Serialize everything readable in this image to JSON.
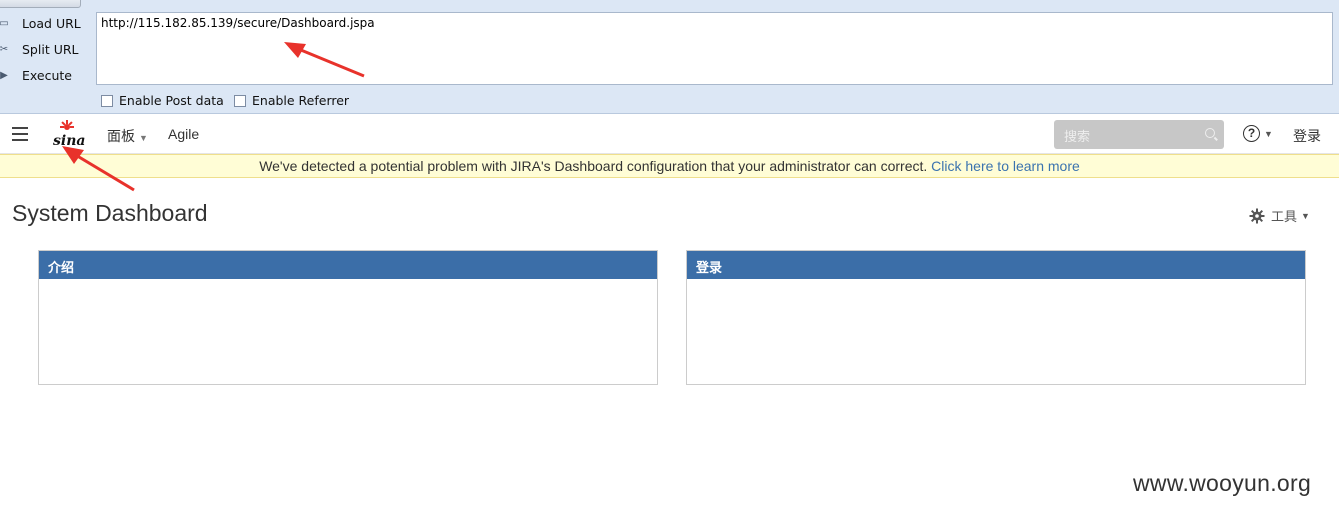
{
  "hackbar": {
    "load_url_label": "Load URL",
    "split_url_label": "Split URL",
    "execute_label": "Execute",
    "url_value": "http://115.182.85.139/secure/Dashboard.jspa",
    "enable_post_label": "Enable Post data",
    "enable_referrer_label": "Enable Referrer"
  },
  "header": {
    "logo_text": "sina",
    "nav_dashboards": "面板",
    "nav_agile": "Agile",
    "search_placeholder": "搜索",
    "login_label": "登录"
  },
  "banner": {
    "message": "We've detected a potential problem with JIRA's Dashboard configuration that your administrator can correct. ",
    "link": "Click here to learn more"
  },
  "dashboard": {
    "title": "System Dashboard",
    "tools_label": "工具",
    "gadgets": [
      {
        "title": "介绍"
      },
      {
        "title": "登录"
      }
    ]
  },
  "watermark": "www.wooyun.org",
  "colors": {
    "gadget_header": "#3b6ea8",
    "link": "#3b73af",
    "banner_bg": "#fffdd6",
    "annotation_arrow": "#e8322b"
  }
}
